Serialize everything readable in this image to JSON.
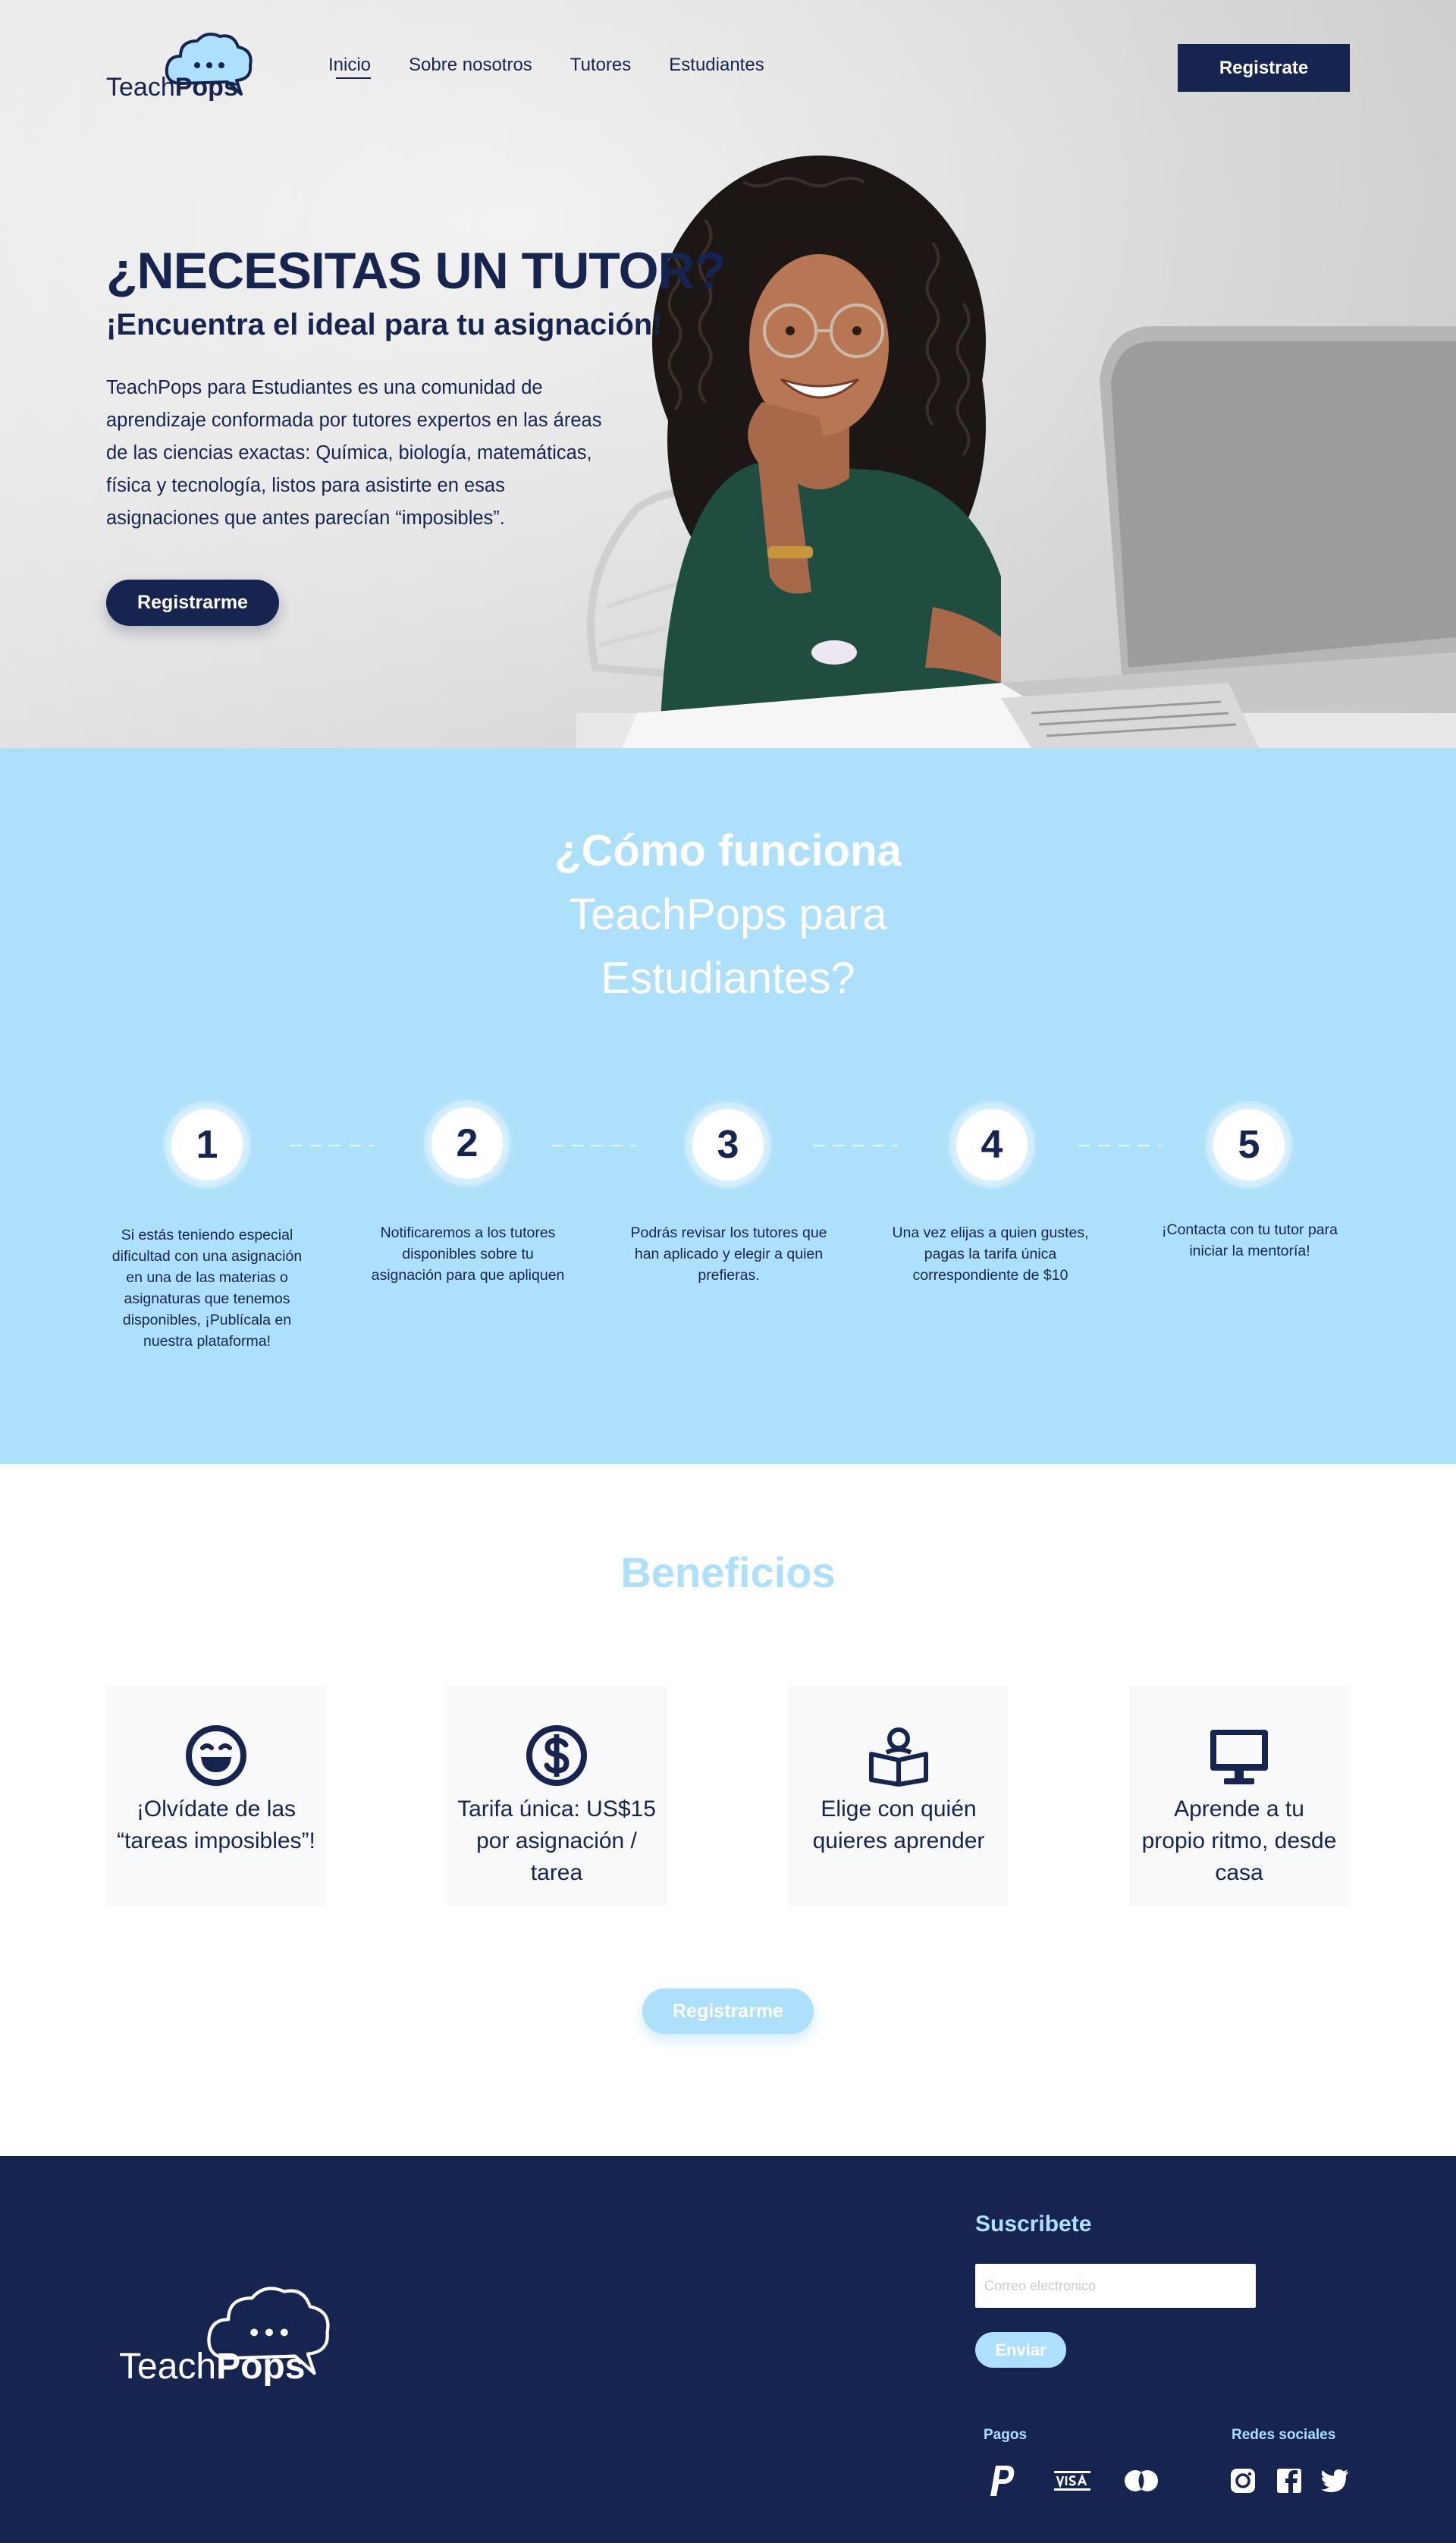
{
  "brand": {
    "name_light": "Teach",
    "name_bold": "Pops"
  },
  "nav": {
    "items": [
      {
        "label": "Inicio",
        "active": true
      },
      {
        "label": "Sobre nosotros",
        "active": false
      },
      {
        "label": "Tutores",
        "active": false
      },
      {
        "label": "Estudiantes",
        "active": false
      }
    ],
    "register_label": "Registrate"
  },
  "hero": {
    "title": "¿NECESITAS UN TUTOR?",
    "subtitle": "¡Encuentra el ideal para tu asignación!",
    "body": "TeachPops para Estudiantes es una comunidad de aprendizaje conformada por tutores expertos en las áreas de las ciencias exactas: Química, biología, matemáticas, física y tecnología, listos para asistirte en esas asignaciones que antes parecían “imposibles”.",
    "cta_label": "Registrarme"
  },
  "how": {
    "title_line1": "¿Cómo funciona",
    "title_line2": "TeachPops para",
    "title_line3": "Estudiantes?",
    "steps": [
      {
        "number": "1",
        "text": "Si estás teniendo especial dificultad con una asignación en una de las materias o asignaturas que tenemos disponibles, ¡Publícala en nuestra plataforma!"
      },
      {
        "number": "2",
        "text": "Notificaremos a los tutores disponibles sobre tu asignación para que apliquen"
      },
      {
        "number": "3",
        "text": "Podrás revisar los tutores que han aplicado y elegir a quien prefieras."
      },
      {
        "number": "4",
        "text": "Una vez elijas a quien gustes, pagas la tarifa única correspondiente de $10"
      },
      {
        "number": "5",
        "text": "¡Contacta con tu tutor para iniciar la mentoría!"
      }
    ]
  },
  "benefits": {
    "title": "Beneficios",
    "items": [
      {
        "icon": "laughing-face-icon",
        "text": "¡Olvídate de las “tareas imposibles”!"
      },
      {
        "icon": "dollar-coin-icon",
        "text": "Tarifa única: US$15 por asignación / tarea"
      },
      {
        "icon": "reader-book-icon",
        "text": "Elige con quién quieres aprender"
      },
      {
        "icon": "monitor-icon",
        "text": "Aprende a tu propio ritmo, desde casa"
      }
    ],
    "cta_label": "Registrarme"
  },
  "footer": {
    "subscribe_title": "Suscribete",
    "email_placeholder": "Correo electronico",
    "send_label": "Enviar",
    "payments_title": "Pagos",
    "payment_icons": [
      "paypal-icon",
      "visa-icon",
      "mastercard-icon"
    ],
    "social_title": "Redes sociales",
    "social_icons": [
      "instagram-icon",
      "facebook-icon",
      "twitter-icon"
    ]
  },
  "colors": {
    "navy": "#16254f",
    "light_blue": "#ade0fb",
    "white": "#ffffff",
    "card_bg": "#f8f9fb"
  }
}
